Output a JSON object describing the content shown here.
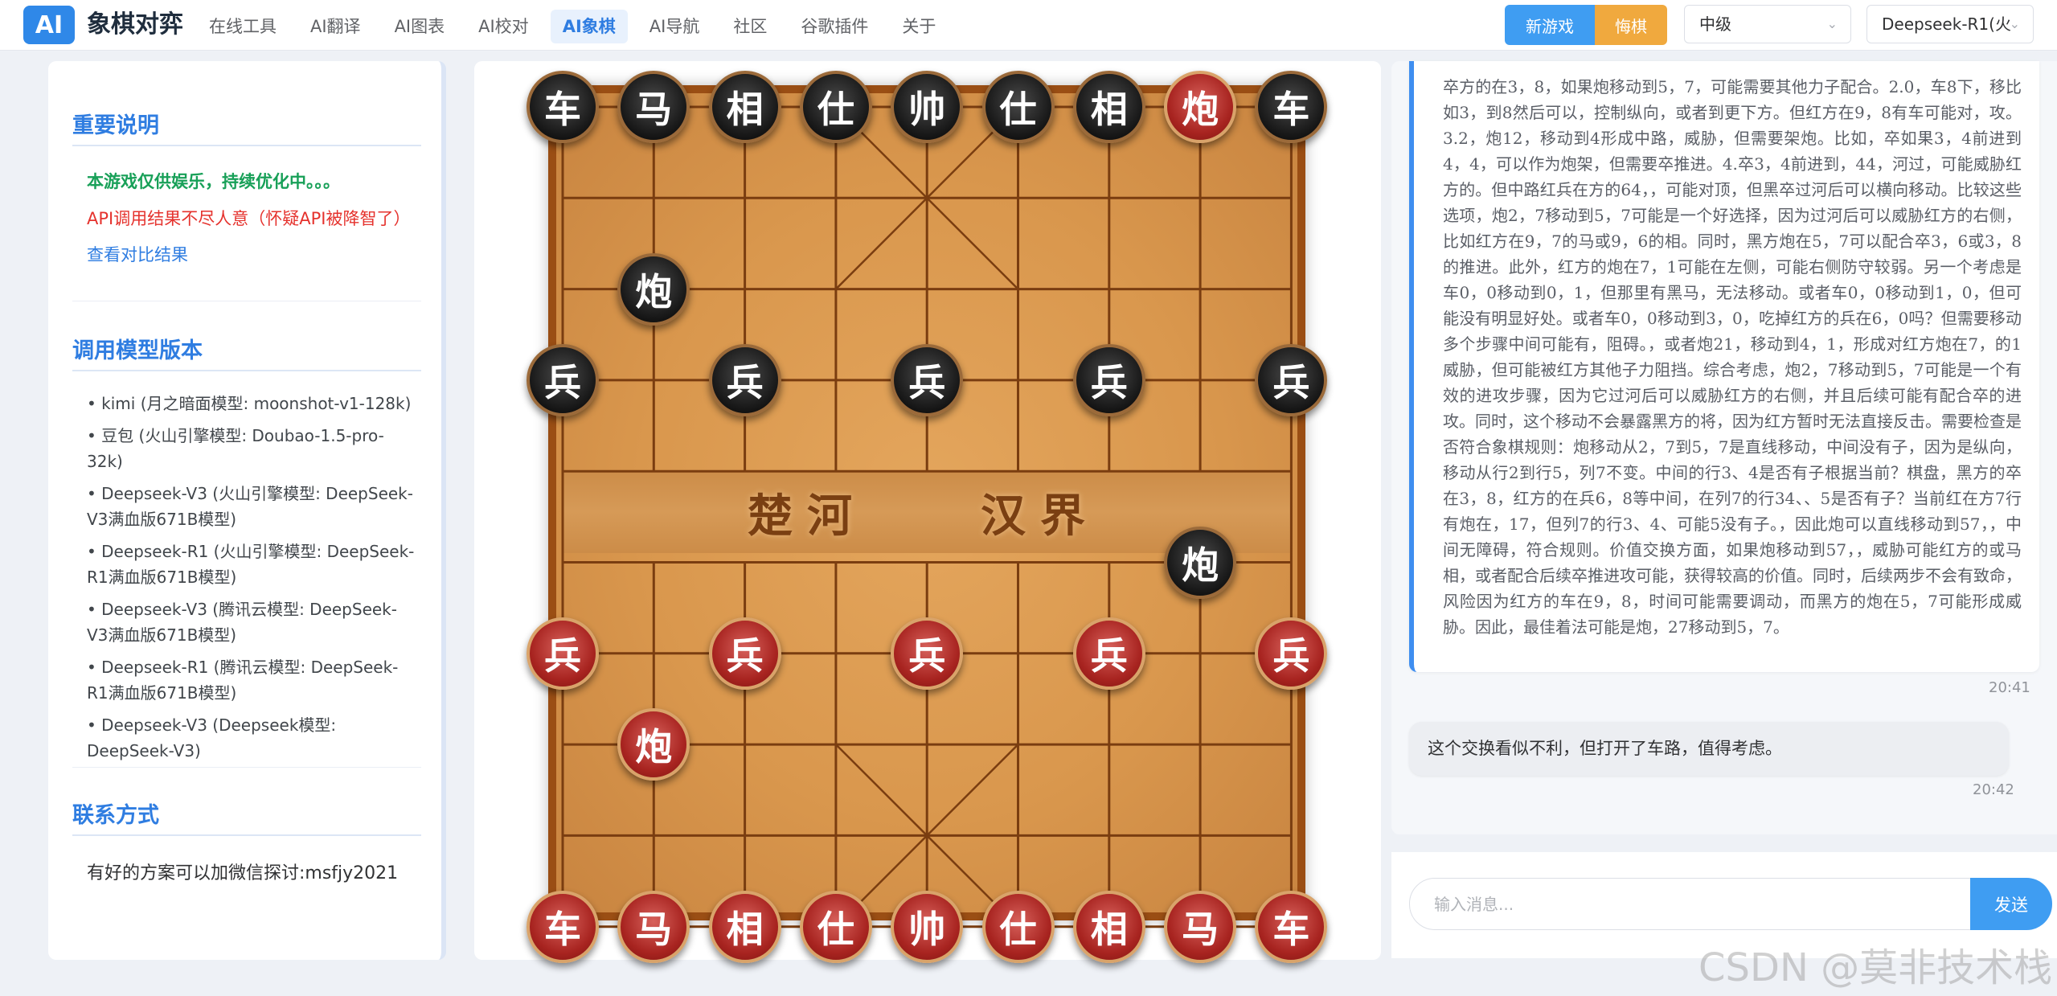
{
  "header": {
    "logo": "AI",
    "title": "象棋对弈",
    "nav": [
      {
        "label": "在线工具",
        "active": false
      },
      {
        "label": "AI翻译",
        "active": false
      },
      {
        "label": "AI图表",
        "active": false
      },
      {
        "label": "AI校对",
        "active": false
      },
      {
        "label": "AI象棋",
        "active": true
      },
      {
        "label": "AI导航",
        "active": false
      },
      {
        "label": "社区",
        "active": false
      },
      {
        "label": "谷歌插件",
        "active": false
      },
      {
        "label": "关于",
        "active": false
      }
    ],
    "new_game": "新游戏",
    "undo": "悔棋",
    "level": "中级",
    "model": "Deepseek-R1(火"
  },
  "sidebar": {
    "notice_title": "重要说明",
    "notice_1": "本游戏仅供娱乐，持续优化中。。。",
    "notice_2": "API调用结果不尽人意（怀疑API被降智了）",
    "notice_link": "查看对比结果",
    "models_title": "调用模型版本",
    "models": [
      "• kimi (月之暗面模型: moonshot-v1-128k)",
      "• 豆包 (火山引擎模型: Doubao-1.5-pro-32k)",
      "• Deepseek-V3 (火山引擎模型: DeepSeek-V3满血版671B模型)",
      "• Deepseek-R1 (火山引擎模型: DeepSeek-R1满血版671B模型)",
      "• Deepseek-V3 (腾讯云模型: DeepSeek-V3满血版671B模型)",
      "• Deepseek-R1 (腾讯云模型: DeepSeek-R1满血版671B模型)",
      "• Deepseek-V3 (Deepseek模型: DeepSeek-V3)"
    ],
    "contact_title": "联系方式",
    "contact_text": "有好的方案可以加微信探讨:msfjy2021"
  },
  "board": {
    "river_left": "楚河",
    "river_right": "汉界",
    "pieces": [
      {
        "char": "车",
        "side": "black",
        "file": 0,
        "rank": 0
      },
      {
        "char": "马",
        "side": "black",
        "file": 1,
        "rank": 0
      },
      {
        "char": "相",
        "side": "black",
        "file": 2,
        "rank": 0
      },
      {
        "char": "仕",
        "side": "black",
        "file": 3,
        "rank": 0
      },
      {
        "char": "帅",
        "side": "black",
        "file": 4,
        "rank": 0
      },
      {
        "char": "仕",
        "side": "black",
        "file": 5,
        "rank": 0
      },
      {
        "char": "相",
        "side": "black",
        "file": 6,
        "rank": 0
      },
      {
        "char": "炮",
        "side": "red",
        "file": 7,
        "rank": 0
      },
      {
        "char": "车",
        "side": "black",
        "file": 8,
        "rank": 0
      },
      {
        "char": "炮",
        "side": "black",
        "file": 1,
        "rank": 2
      },
      {
        "char": "兵",
        "side": "black",
        "file": 0,
        "rank": 3
      },
      {
        "char": "兵",
        "side": "black",
        "file": 2,
        "rank": 3
      },
      {
        "char": "兵",
        "side": "black",
        "file": 4,
        "rank": 3
      },
      {
        "char": "兵",
        "side": "black",
        "file": 6,
        "rank": 3
      },
      {
        "char": "兵",
        "side": "black",
        "file": 8,
        "rank": 3
      },
      {
        "char": "炮",
        "side": "black",
        "file": 7,
        "rank": 5
      },
      {
        "char": "兵",
        "side": "red",
        "file": 0,
        "rank": 6
      },
      {
        "char": "兵",
        "side": "red",
        "file": 2,
        "rank": 6
      },
      {
        "char": "兵",
        "side": "red",
        "file": 4,
        "rank": 6
      },
      {
        "char": "兵",
        "side": "red",
        "file": 6,
        "rank": 6
      },
      {
        "char": "兵",
        "side": "red",
        "file": 8,
        "rank": 6
      },
      {
        "char": "炮",
        "side": "red",
        "file": 1,
        "rank": 7
      },
      {
        "char": "车",
        "side": "red",
        "file": 0,
        "rank": 9
      },
      {
        "char": "马",
        "side": "red",
        "file": 1,
        "rank": 9
      },
      {
        "char": "相",
        "side": "red",
        "file": 2,
        "rank": 9
      },
      {
        "char": "仕",
        "side": "red",
        "file": 3,
        "rank": 9
      },
      {
        "char": "帅",
        "side": "red",
        "file": 4,
        "rank": 9
      },
      {
        "char": "仕",
        "side": "red",
        "file": 5,
        "rank": 9
      },
      {
        "char": "相",
        "side": "red",
        "file": 6,
        "rank": 9
      },
      {
        "char": "马",
        "side": "red",
        "file": 7,
        "rank": 9
      },
      {
        "char": "车",
        "side": "red",
        "file": 8,
        "rank": 9
      }
    ]
  },
  "chat": {
    "ai_message": "卒方的在3，8，如果炮移动到5，7，可能需要其他力子配合。2.0，车8下，移比如3，到8然后可以，控制纵向，或者到更下方。但红方在9，8有车可能对，攻。3.2，炮12，移动到4形成中路，威胁，但需要架炮。比如，卒如果3，4前进到4，4，可以作为炮架，但需要卒推进。4.卒3，4前进到，44，河过，可能威胁红方的。但中路红兵在方的64，，可能对顶，但黑卒过河后可以横向移动。比较这些选项，炮2，7移动到5，7可能是一个好选择，因为过河后可以威胁红方的右侧，比如红方在9，7的马或9，6的相。同时，黑方炮在5，7可以配合卒3，6或3，8的推进。此外，红方的炮在7，1可能在左侧，可能右侧防守较弱。另一个考虑是车0，0移动到0，1，但那里有黑马，无法移动。或者车0，0移动到1，0，但可能没有明显好处。或者车0，0移动到3，0，吃掉红方的兵在6，0吗？但需要移动多个步骤中间可能有，阻碍。，或者炮21，移动到4，1，形成对红方炮在7，的1威胁，但可能被红方其他子力阻挡。综合考虑，炮2，7移动到5，7可能是一个有效的进攻步骤，因为它过河后可以威胁红方的右侧，并且后续可能有配合卒的进攻。同时，这个移动不会暴露黑方的将，因为红方暂时无法直接反击。需要检查是否符合象棋规则：炮移动从2，7到5，7是直线移动，中间没有子，因为是纵向，移动从行2到行5，列7不变。中间的行3、4是否有子根据当前？棋盘，黑方的卒在3，8，红方的在兵6，8等中间，在列7的行34、、5是否有子？当前红在方7行有炮在，17，但列7的行3、4、可能5没有子。，因此炮可以直线移动到57，，中间无障碍，符合规则。价值交换方面，如果炮移动到57，，威胁可能红方的或马相，或者配合后续卒推进攻可能，获得较高的价值。同时，后续两步不会有致命，风险因为红方的车在9，8，时间可能需要调动，而黑方的炮在5，7可能形成威胁。因此，最佳着法可能是炮，27移动到5，7。",
    "ai_time": "20:41",
    "user_message": "这个交换看似不利，但打开了车路，值得考虑。",
    "user_time": "20:42",
    "input_placeholder": "输入消息...",
    "send_label": "发送"
  },
  "watermark": "CSDN @莫非技术栈"
}
